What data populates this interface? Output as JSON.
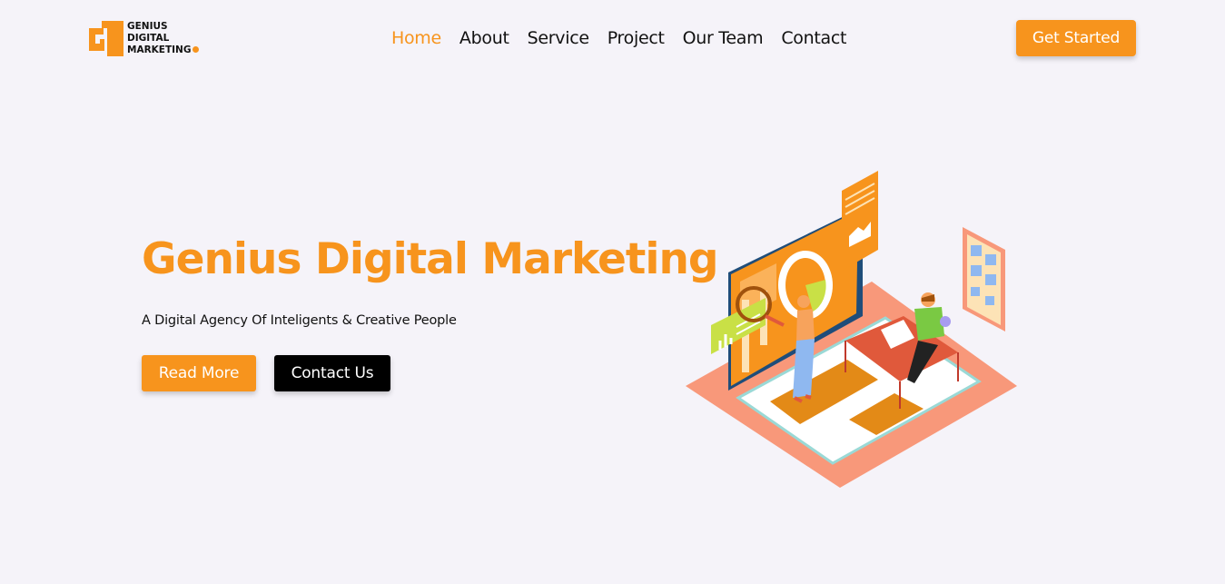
{
  "brand": {
    "logo_lines": [
      "GENIUS",
      "DIGITAL",
      "MARKETING"
    ],
    "accent": "#f7941d"
  },
  "nav": {
    "items": [
      {
        "label": "Home",
        "active": true
      },
      {
        "label": "About",
        "active": false
      },
      {
        "label": "Service",
        "active": false
      },
      {
        "label": "Project",
        "active": false
      },
      {
        "label": "Our Team",
        "active": false
      },
      {
        "label": "Contact",
        "active": false
      }
    ]
  },
  "header": {
    "cta_label": "Get Started"
  },
  "hero": {
    "title": "Genius Digital Marketing",
    "subtitle": "A Digital Agency Of Inteligents & Creative People",
    "primary_button": "Read More",
    "secondary_button": "Contact Us",
    "illustration_icon": "marketing-analytics-illustration"
  },
  "colors": {
    "background": "#f5f3f9",
    "accent": "#f7941d",
    "dark": "#000000",
    "platform": "#f8987a"
  }
}
